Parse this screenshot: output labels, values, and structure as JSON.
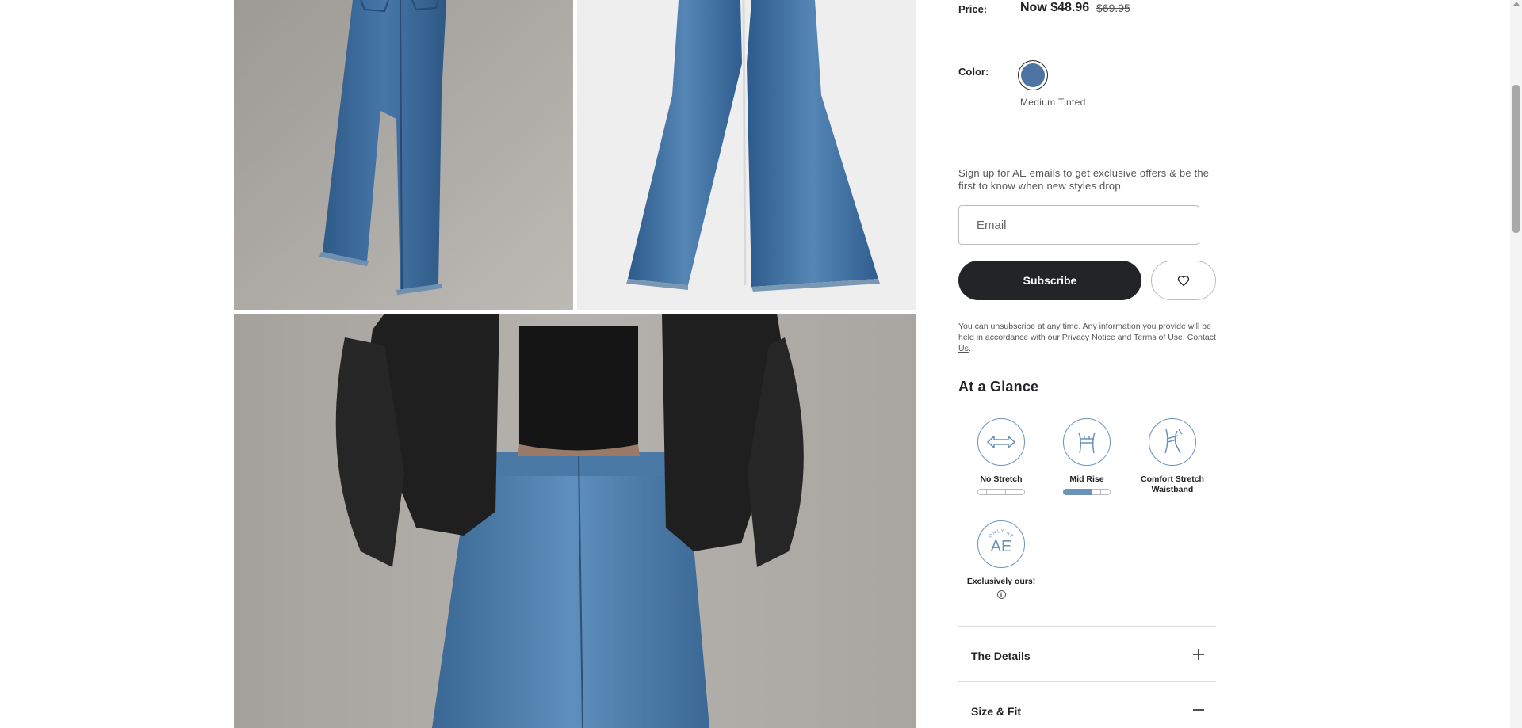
{
  "price": {
    "label": "Price:",
    "now": "Now $48.96",
    "was": "$69.95"
  },
  "color": {
    "label": "Color:",
    "selected_name": "Medium Tinted",
    "swatch_hex": "#4d74a3"
  },
  "signup": {
    "text": "Sign up for AE emails to get exclusive offers & be the first to know when new styles drop.",
    "email_placeholder": "Email",
    "subscribe_label": "Subscribe",
    "legal_intro": "You can unsubscribe at any time. Any information you provide will be held in accordance with our ",
    "privacy_link": "Privacy Notice",
    "and_text": " and ",
    "terms_link": "Terms of Use",
    "period": ". ",
    "contact_link": "Contact Us",
    "end": "."
  },
  "glance": {
    "title": "At a Glance",
    "features": [
      {
        "label": "No Stretch",
        "icon": "stretch-arrows-icon",
        "level": 0,
        "max": 5
      },
      {
        "label": "Mid Rise",
        "icon": "rise-waist-icon",
        "level": 3,
        "max": 5
      },
      {
        "label": "Comfort Stretch Waistband",
        "icon": "waistband-icon"
      },
      {
        "label": "Exclusively ours!",
        "icon": "only-at-ae-icon",
        "badge_top": "ONLY AT",
        "badge_main": "AE"
      }
    ]
  },
  "accordions": [
    {
      "title": "The Details",
      "state": "collapsed",
      "icon": "plus-icon"
    },
    {
      "title": "Size & Fit",
      "state": "expanded",
      "icon": "minus-icon"
    }
  ],
  "colors": {
    "ink": "#222427",
    "accent_blue": "#6b93b9",
    "denim": "#3d6a9b"
  }
}
